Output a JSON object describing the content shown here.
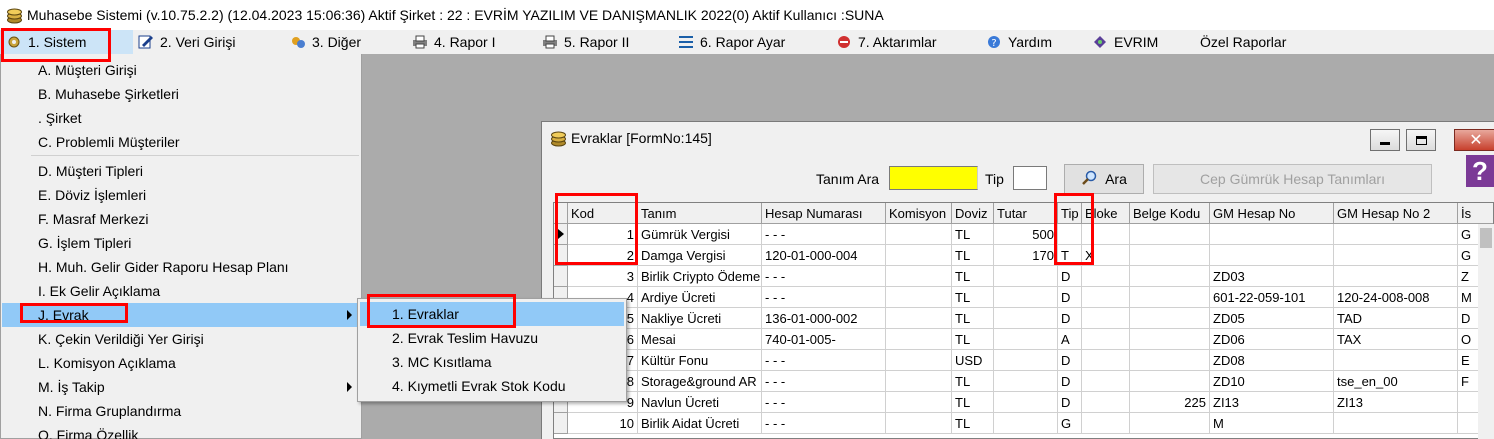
{
  "window": {
    "title": "Muhasebe Sistemi (v.10.75.2.2) (12.04.2023 15:06:36) Aktif Şirket : 22 : EVRİM YAZILIM  VE DANIŞMANLIK 2022(0) Aktif Kullanıcı :SUNA"
  },
  "menubar": {
    "items": [
      {
        "label": "1.  Sistem"
      },
      {
        "label": "2.  Veri Girişi"
      },
      {
        "label": "3.  Diğer"
      },
      {
        "label": "4.   Rapor I"
      },
      {
        "label": "5.   Rapor II"
      },
      {
        "label": "6.   Rapor Ayar"
      },
      {
        "label": "7.  Aktarımlar"
      },
      {
        "label": "Yardım"
      },
      {
        "label": "EVRIM"
      },
      {
        "label": "Özel Raporlar"
      }
    ]
  },
  "sistem_menu": {
    "items": [
      {
        "label": "A.  Müşteri Girişi"
      },
      {
        "label": "B.  Muhasebe Şirketleri"
      },
      {
        "label": ".  Şirket"
      },
      {
        "label": "C.  Problemli Müşteriler"
      },
      {
        "label": "D.  Müşteri Tipleri"
      },
      {
        "label": "E.  Döviz İşlemleri"
      },
      {
        "label": "F.  Masraf Merkezi"
      },
      {
        "label": "G.  İşlem Tipleri"
      },
      {
        "label": "H.  Muh. Gelir Gider Raporu Hesap Planı"
      },
      {
        "label": "I.  Ek Gelir Açıklama"
      },
      {
        "label": "J.  Evrak"
      },
      {
        "label": "K.  Çekin Verildiği Yer Girişi"
      },
      {
        "label": "L.  Komisyon Açıklama"
      },
      {
        "label": "M.  İş Takip"
      },
      {
        "label": "N.  Firma Gruplandırma"
      },
      {
        "label": "O.  Firma Özellik"
      }
    ]
  },
  "evrak_submenu": {
    "items": [
      {
        "label": "1.  Evraklar"
      },
      {
        "label": "2.  Evrak Teslim Havuzu"
      },
      {
        "label": "3.  MC Kısıtlama"
      },
      {
        "label": "4. Kıymetli Evrak Stok Kodu"
      }
    ]
  },
  "evraklar": {
    "title": "Evraklar [FormNo:145]",
    "tanim_ara_label": "Tanım Ara",
    "search_value": "",
    "tip_label": "Tip",
    "tip_value": "",
    "ara_button": "Ara",
    "cep_button": "Cep Gümrük Hesap Tanımları",
    "columns": [
      "Kod",
      "Tanım",
      "Hesap Numarası",
      "Komisyon",
      "Doviz",
      "Tutar",
      "Tip",
      "Bloke",
      "Belge Kodu",
      "GM Hesap No",
      "GM Hesap No 2",
      "İs"
    ],
    "rows": [
      [
        "1",
        "Gümrük Vergisi",
        " - - -",
        "",
        "TL",
        "500",
        "",
        "",
        "",
        "",
        "",
        "G"
      ],
      [
        "2",
        "Damga Vergisi",
        "120-01-000-004",
        "",
        "TL",
        "170",
        "T",
        "X",
        "",
        "",
        "",
        "G"
      ],
      [
        "3",
        "Birlik Criypto Ödeme",
        " - - -",
        "",
        "TL",
        "",
        "D",
        "",
        "",
        "ZD03",
        "",
        "Z"
      ],
      [
        "4",
        "Ardiye Ücreti",
        " - - -",
        "",
        "TL",
        "",
        "D",
        "",
        "",
        "601-22-059-101",
        "120-24-008-008",
        "M"
      ],
      [
        "5",
        "Nakliye Ücreti",
        "136-01-000-002",
        "",
        "TL",
        "",
        "D",
        "",
        "",
        "ZD05",
        "TAD",
        "D"
      ],
      [
        "6",
        "Mesai",
        "740-01-005-",
        "",
        "TL",
        "",
        "A",
        "",
        "",
        "ZD06",
        "TAX",
        "O"
      ],
      [
        "7",
        "Kültür Fonu",
        " - - -",
        "",
        "USD",
        "",
        "D",
        "",
        "",
        "ZD08",
        "",
        "E"
      ],
      [
        "8",
        "Storage&ground AR",
        " - - -",
        "",
        "TL",
        "",
        "D",
        "",
        "",
        "ZD10",
        "tse_en_00",
        "F"
      ],
      [
        "9",
        "Navlun Ücreti",
        " - - -",
        "",
        "TL",
        "",
        "D",
        "",
        "225",
        "ZI13",
        "ZI13",
        ""
      ],
      [
        "10",
        "Birlik Aidat Ücreti",
        " - - -",
        "",
        "TL",
        "",
        "G",
        "",
        "",
        "M",
        "",
        ""
      ]
    ]
  },
  "colors": {
    "highlight_red": "#ff0000",
    "menu_highlight": "#91c9f7",
    "search_yellow": "#ffff00",
    "mdi_gray": "#ababab"
  }
}
